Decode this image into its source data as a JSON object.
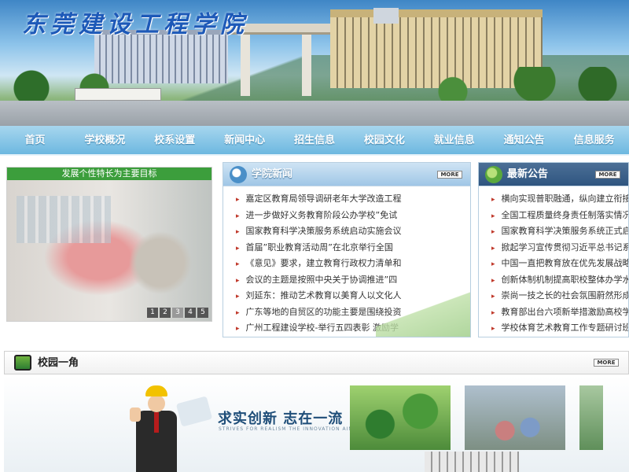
{
  "banner": {
    "title": "东莞建设工程学院"
  },
  "nav": {
    "items": [
      "首页",
      "学校概况",
      "校系设置",
      "新闻中心",
      "招生信息",
      "校园文化",
      "就业信息",
      "通知公告",
      "信息服务"
    ]
  },
  "slideshow": {
    "caption": "发展个性特长为主要目标",
    "pages": [
      "1",
      "2",
      "3",
      "4",
      "5"
    ]
  },
  "news": {
    "title": "学院新闻",
    "more": "MORE",
    "items": [
      "嘉定区教育局领导调研老年大学改造工程",
      "进一步做好义务教育阶段公办学校”免试",
      "国家教育科学决策服务系统启动实施会议",
      "首届”职业教育活动周”在北京举行全国",
      "《意见》要求，建立教育行政权力清单和",
      "会议的主题是按照中央关于协调推进”四",
      "刘延东：推动艺术教育以美育人以文化人",
      "广东等地的自贸区的功能主要是围绕投资",
      "广州工程建设学校-举行五四表彰 激励学"
    ]
  },
  "notice": {
    "title": "最新公告",
    "more": "MORE",
    "items": [
      "横向实现普职融通，纵向建立衔接...",
      "全国工程质量终身责任制落实情况...",
      "国家教育科学决策服务系统正式启...",
      "掀起学习宣传贯彻习近平总书记系...",
      "中国一直把教育放在优先发展战略...",
      "创新体制机制提高职校整体办学水...",
      "崇尚一技之长的社会氛围蔚然形成...",
      "教育部出台六项新举措激励高校学...",
      "学校体育艺术教育工作专题研讨班..."
    ]
  },
  "corner": {
    "title": "校园一角",
    "more": "MORE",
    "slogan": "求实创新  志在一流",
    "slogan_en": "STRIVES FOR REALISM THE INNOVATION AIM A"
  }
}
